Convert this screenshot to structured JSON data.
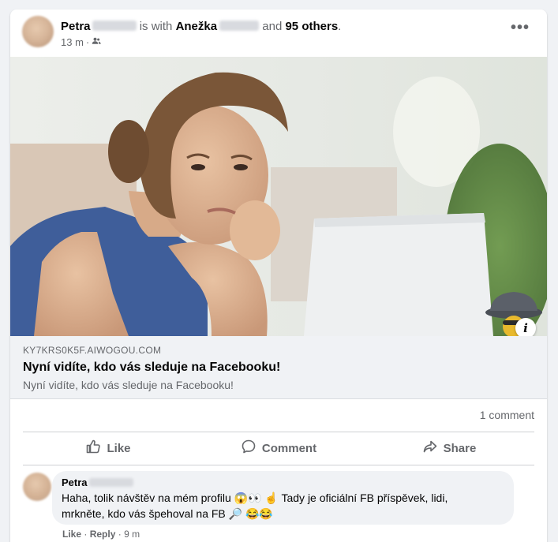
{
  "post": {
    "author_name": "Petra",
    "with_text": "is with",
    "tagged_name": "Anežka",
    "and_text": "and",
    "others_text": "95 others",
    "period": ".",
    "time": "13 m",
    "audience_icon": "friends-icon",
    "more_icon": "more-dots-icon",
    "more_label": "•••"
  },
  "link": {
    "domain": "KY7KRS0K5F.AIWOGOU.COM",
    "title": "Nyní vidíte, kdo vás sleduje na Facebooku!",
    "description": "Nyní vidíte, kdo vás sleduje na Facebooku!",
    "info_label": "i"
  },
  "stats": {
    "comments": "1 comment"
  },
  "actions": {
    "like": "Like",
    "comment": "Comment",
    "share": "Share"
  },
  "comment": {
    "author": "Petra",
    "line1": "Haha, tolik návštěv na mém profilu 😱👀 ☝️ Tady je oficiální FB příspěvek, lidi,",
    "line2": "mrkněte, kdo vás špehoval na FB 🔎 😂😂",
    "like": "Like",
    "reply": "Reply",
    "time": "9 m"
  },
  "colors": {
    "background": "#f0f2f5",
    "secondary_text": "#65676b",
    "primary_text": "#050505"
  }
}
